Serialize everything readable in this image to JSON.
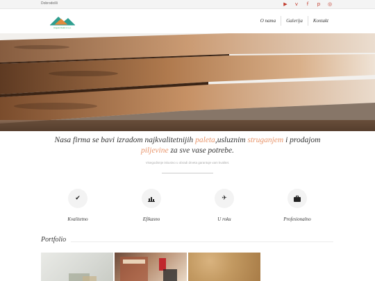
{
  "topbar": {
    "welcome": "Dobrodošli",
    "social_icons": [
      "youtube-icon",
      "vimeo-icon",
      "facebook-icon",
      "pinterest-icon",
      "instagram-icon"
    ],
    "social_color": "#c0392b"
  },
  "header": {
    "logo_text": "Angelo Dekic d.o.o.",
    "nav": [
      "O nama",
      "Galerija",
      "Kontakt"
    ]
  },
  "intro": {
    "line1_before": "Nasa firma se bavi izradom najkvalitetnijih ",
    "line1_hl1": "paleta",
    "line1_mid": ",usluznim ",
    "line1_hl2": "struganjem",
    "line1_after": " i prodajom",
    "line2_hl": "piljevine",
    "line2_after": " za sve vase potrebe.",
    "highlight_color": "#e8956b",
    "subtext": "Visegodisnje iskustvo u obradi drveta garantuje vam kvalitet."
  },
  "features": [
    {
      "label": "Kvalitetno",
      "icon": "checkmark-icon"
    },
    {
      "label": "Efikasno",
      "icon": "bar-chart-icon"
    },
    {
      "label": "U roku",
      "icon": "plane-icon"
    },
    {
      "label": "Profesionalno",
      "icon": "briefcase-icon"
    }
  ],
  "portfolio": {
    "title": "Portfolio"
  }
}
